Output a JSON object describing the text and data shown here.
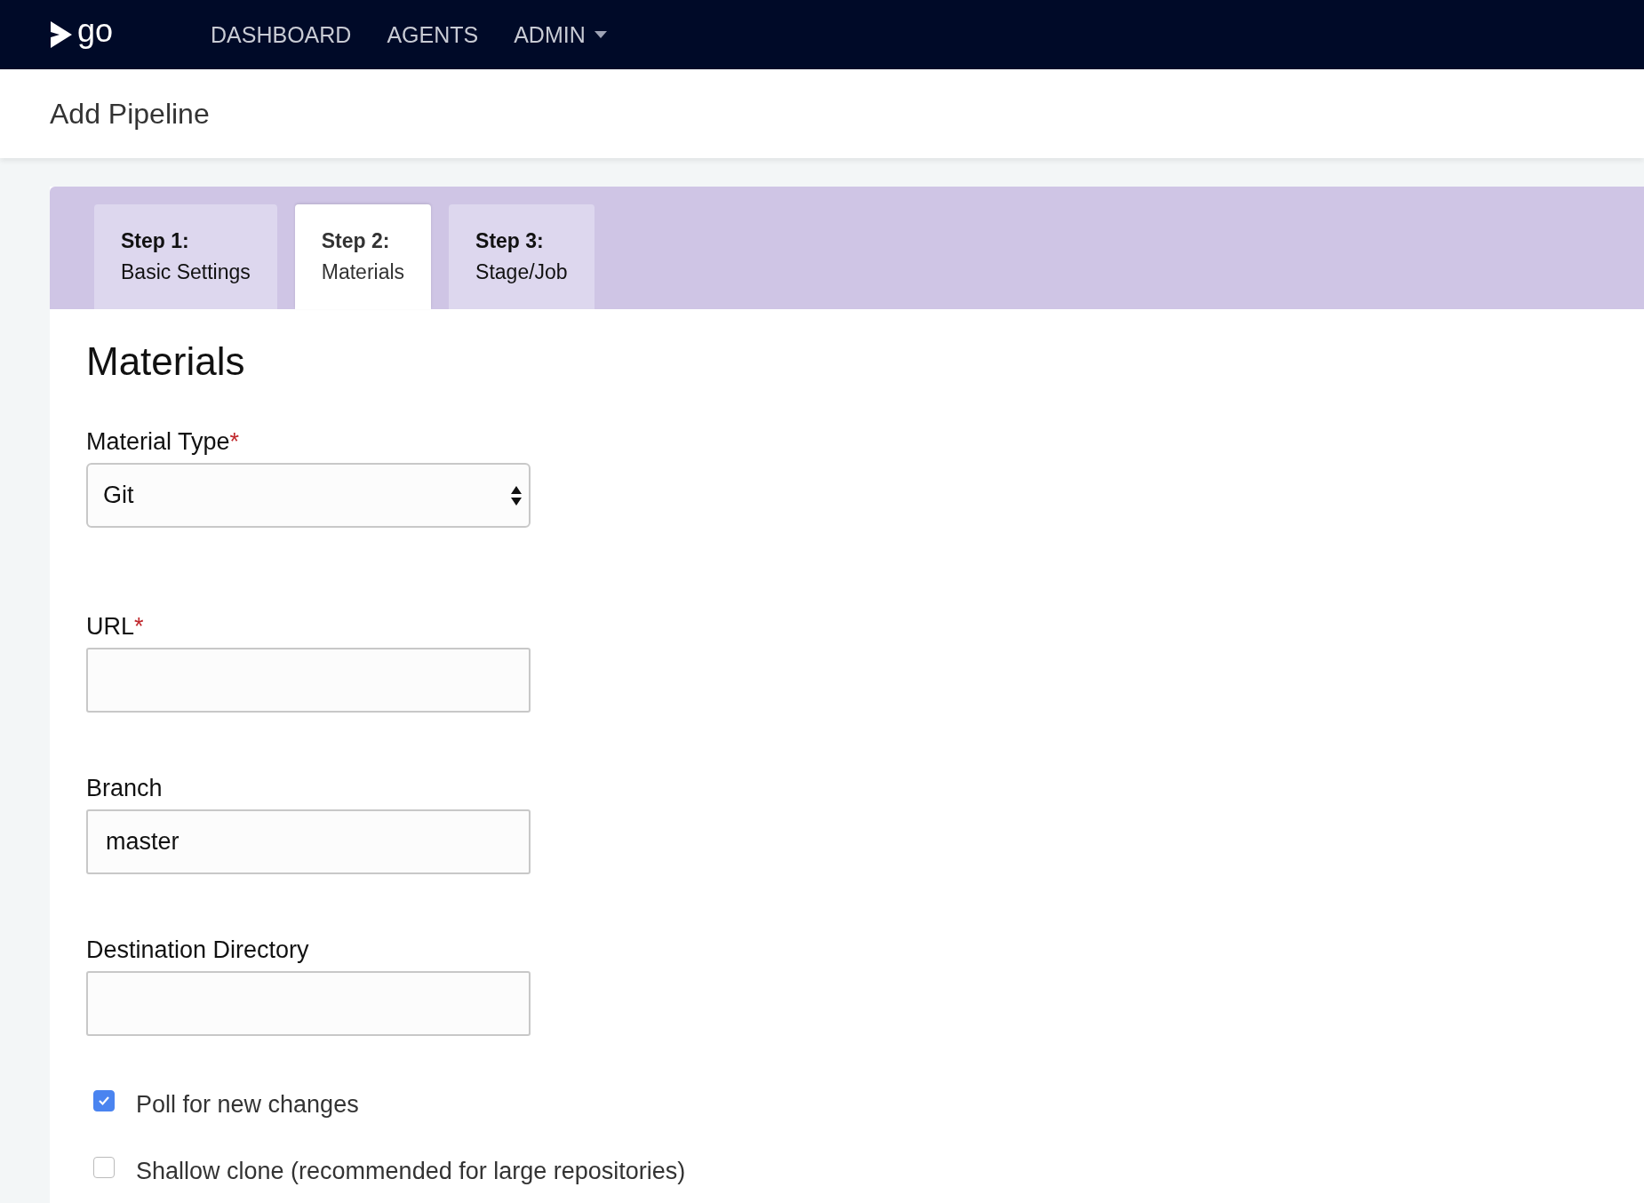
{
  "header": {
    "logo_text": "go",
    "nav": [
      {
        "label": "DASHBOARD",
        "dropdown": false
      },
      {
        "label": "AGENTS",
        "dropdown": false
      },
      {
        "label": "ADMIN",
        "dropdown": true
      }
    ]
  },
  "page_title": "Add Pipeline",
  "tabs": [
    {
      "step": "Step 1:",
      "label": "Basic Settings",
      "selected": false
    },
    {
      "step": "Step 2:",
      "label": "Materials",
      "selected": true
    },
    {
      "step": "Step 3:",
      "label": "Stage/Job",
      "selected": false
    }
  ],
  "section_title": "Materials",
  "fields": [
    {
      "kind": "select",
      "label": "Material Type",
      "required_mark": "*",
      "value": "Git"
    },
    {
      "kind": "text",
      "label": "URL",
      "required_mark": "*"
    },
    {
      "kind": "text",
      "label": "Branch",
      "value": "master"
    },
    {
      "kind": "text",
      "label": "Destination Directory"
    }
  ],
  "checkboxes": [
    {
      "label": "Poll for new changes",
      "checked": true
    },
    {
      "label": "Shallow clone (recommended for large repositories)",
      "checked": false
    }
  ]
}
